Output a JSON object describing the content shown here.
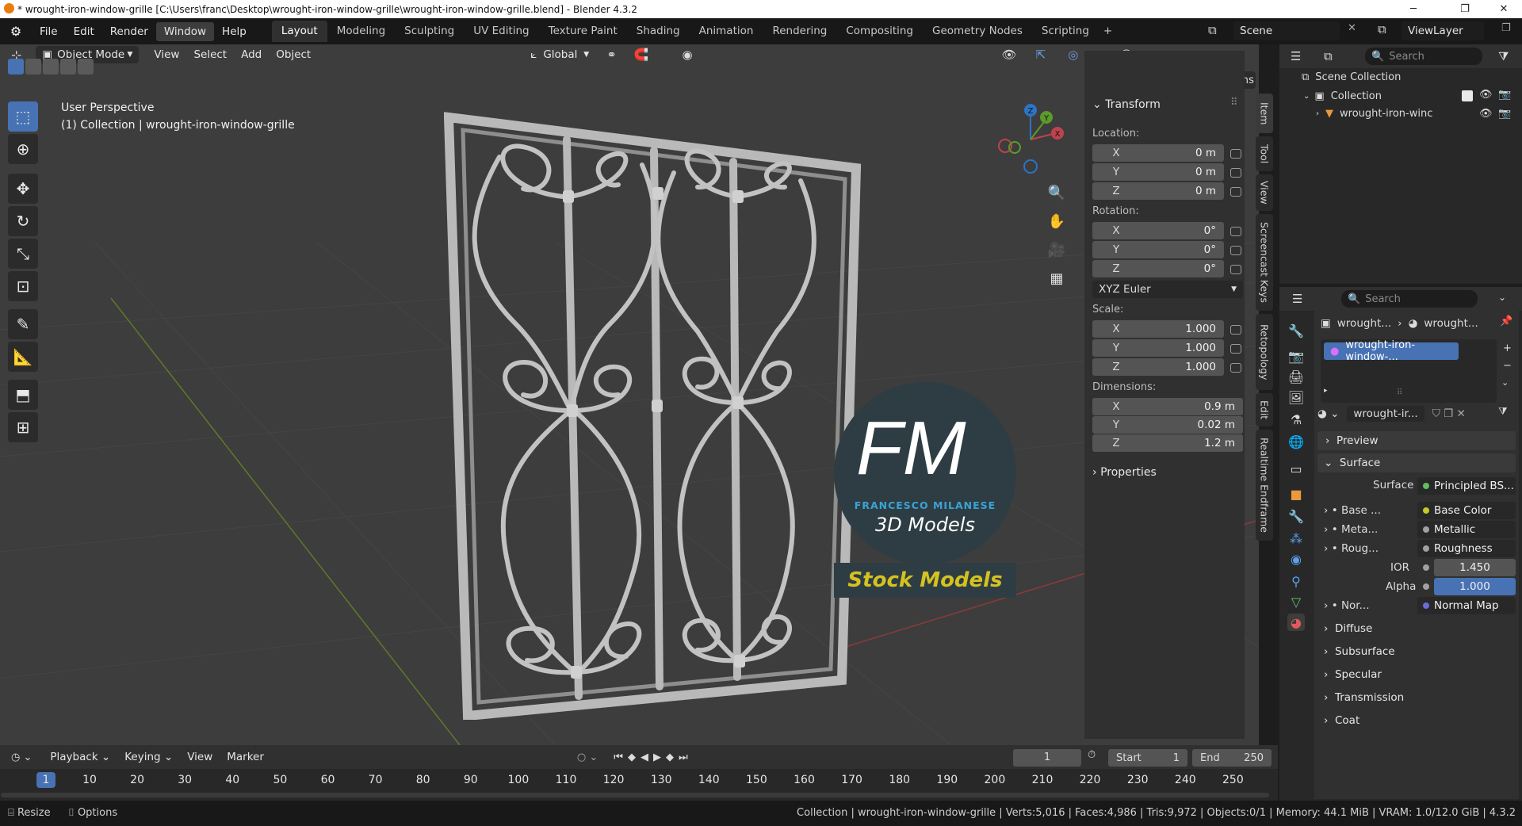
{
  "window": {
    "title": "* wrought-iron-window-grille [C:\\Users\\franc\\Desktop\\wrought-iron-window-grille\\wrought-iron-window-grille.blend] - Blender 4.3.2",
    "min": "─",
    "max": "❐",
    "close": "✕"
  },
  "menu": [
    "File",
    "Edit",
    "Render",
    "Window",
    "Help"
  ],
  "workspaces": [
    "Layout",
    "Modeling",
    "Sculpting",
    "UV Editing",
    "Texture Paint",
    "Shading",
    "Animation",
    "Rendering",
    "Compositing",
    "Geometry Nodes",
    "Scripting"
  ],
  "add_ws": "+",
  "scene": "Scene",
  "viewlayer": "ViewLayer",
  "viewport": {
    "mode": "Object Mode",
    "menus": [
      "View",
      "Select",
      "Add",
      "Object"
    ],
    "orientation": "Global",
    "options": "Options",
    "perspective": "User Perspective",
    "collection_info": "(1) Collection | wrought-iron-window-grille"
  },
  "gizmo": {
    "x": "X",
    "y": "Y",
    "z": "Z"
  },
  "logo": {
    "letters": "FM",
    "name": "FRANCESCO MILANESE",
    "sub": "3D Models",
    "banner": "Stock Models"
  },
  "npanel": {
    "transform": "Transform",
    "location_label": "Location:",
    "location": [
      {
        "ax": "X",
        "v": "0 m"
      },
      {
        "ax": "Y",
        "v": "0 m"
      },
      {
        "ax": "Z",
        "v": "0 m"
      }
    ],
    "rotation_label": "Rotation:",
    "rotation": [
      {
        "ax": "X",
        "v": "0°"
      },
      {
        "ax": "Y",
        "v": "0°"
      },
      {
        "ax": "Z",
        "v": "0°"
      }
    ],
    "rotation_mode": "XYZ Euler",
    "scale_label": "Scale:",
    "scale": [
      {
        "ax": "X",
        "v": "1.000"
      },
      {
        "ax": "Y",
        "v": "1.000"
      },
      {
        "ax": "Z",
        "v": "1.000"
      }
    ],
    "dimensions_label": "Dimensions:",
    "dimensions": [
      {
        "ax": "X",
        "v": "0.9 m"
      },
      {
        "ax": "Y",
        "v": "0.02 m"
      },
      {
        "ax": "Z",
        "v": "1.2 m"
      }
    ],
    "properties": "Properties"
  },
  "sidetabs": [
    "Item",
    "Tool",
    "View",
    "Screencast Keys",
    "Retopology",
    "Edit",
    "Realtime Endframe"
  ],
  "outliner": {
    "search": "Search",
    "scene_collection": "Scene Collection",
    "collection": "Collection",
    "object": "wrought-iron-winc"
  },
  "props": {
    "search": "Search",
    "crumb1": "wrought...",
    "crumb2": "wrought...",
    "material_slot": "wrought-iron-window-...",
    "material_name": "wrought-ir...",
    "preview": "Preview",
    "surface_section": "Surface",
    "surface_label": "Surface",
    "surface_value": "Principled BS...",
    "rows": [
      {
        "label": "Base ...",
        "value": "Base Color",
        "color": "#c7c729"
      },
      {
        "label": "Meta...",
        "value": "Metallic",
        "color": "#a1a1a1"
      },
      {
        "label": "Roug...",
        "value": "Roughness",
        "color": "#a1a1a1"
      }
    ],
    "ior_label": "IOR",
    "ior": "1.450",
    "alpha_label": "Alpha",
    "alpha": "1.000",
    "normal_label": "Nor...",
    "normal_value": "Normal Map",
    "sections": [
      "Diffuse",
      "Subsurface",
      "Specular",
      "Transmission",
      "Coat"
    ]
  },
  "timeline": {
    "menus": [
      "Playback",
      "Keying",
      "View",
      "Marker"
    ],
    "current_frame": "1",
    "start_label": "Start",
    "start": "1",
    "end_label": "End",
    "end": "250",
    "ticks": [
      "1",
      "10",
      "20",
      "30",
      "40",
      "50",
      "60",
      "70",
      "80",
      "90",
      "100",
      "110",
      "120",
      "130",
      "140",
      "150",
      "160",
      "170",
      "180",
      "190",
      "200",
      "210",
      "220",
      "230",
      "240",
      "250"
    ]
  },
  "status": {
    "resize": "Resize",
    "options": "Options",
    "info": "Collection | wrought-iron-window-grille | Verts:5,016 | Faces:4,986 | Tris:9,972 | Objects:0/1 | Memory: 44.1 MiB | VRAM: 1.0/12.0 GiB | 4.3.2"
  }
}
